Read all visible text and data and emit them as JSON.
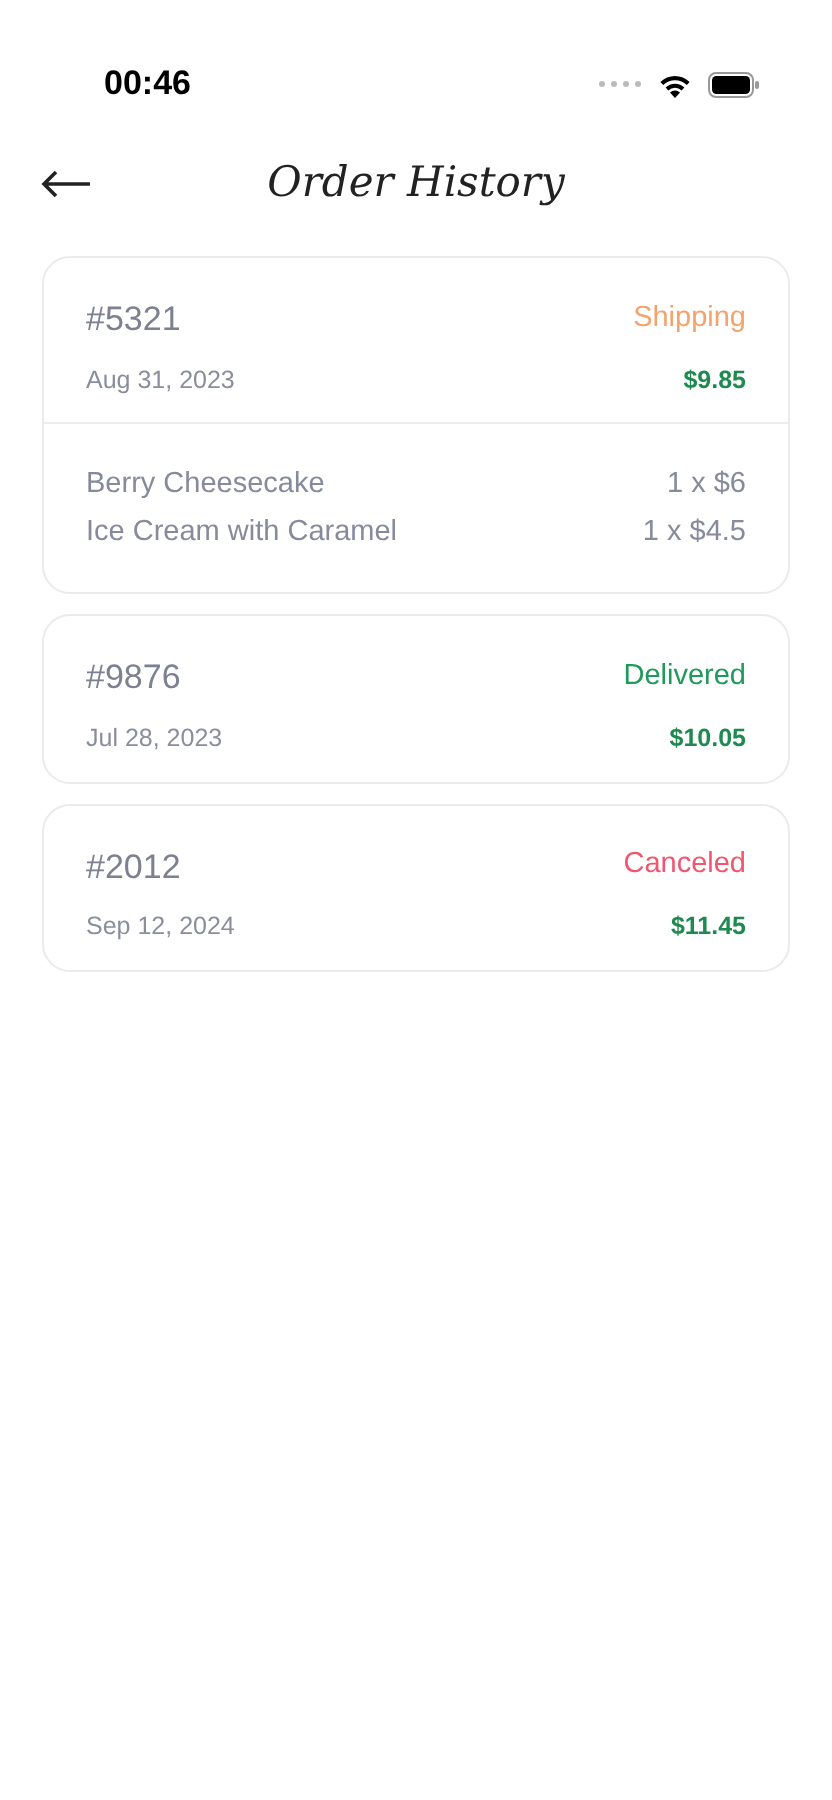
{
  "status_bar": {
    "time": "00:46"
  },
  "header": {
    "title": "Order History"
  },
  "orders": [
    {
      "number": "#5321",
      "status": "Shipping",
      "color": "#f5a26b",
      "date": "Aug 31, 2023",
      "total": "$9.85",
      "items": [
        {
          "name": "Berry Cheesecake",
          "qty": "1 x $6"
        },
        {
          "name": "Ice Cream with Caramel",
          "qty": "1 x $4.5"
        }
      ]
    },
    {
      "number": "#9876",
      "status": "Delivered",
      "color": "#1f9a5a",
      "date": "Jul 28, 2023",
      "total": "$10.05"
    },
    {
      "number": "#2012",
      "status": "Canceled",
      "color": "#f0566e",
      "date": "Sep 12, 2024",
      "total": "$11.45"
    }
  ]
}
